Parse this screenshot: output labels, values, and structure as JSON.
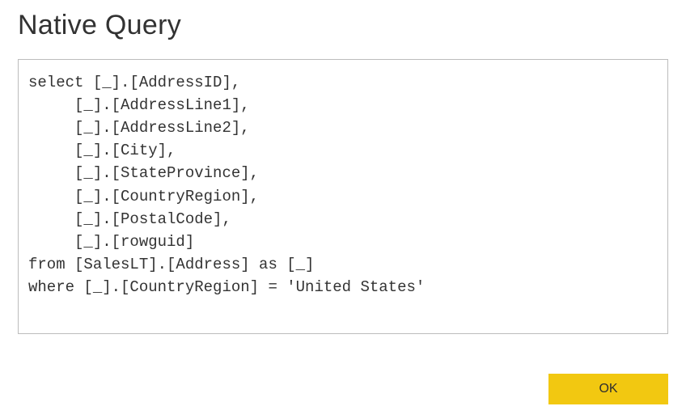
{
  "dialog": {
    "title": "Native Query"
  },
  "query": {
    "text": "select [_].[AddressID],\n     [_].[AddressLine1],\n     [_].[AddressLine2],\n     [_].[City],\n     [_].[StateProvince],\n     [_].[CountryRegion],\n     [_].[PostalCode],\n     [_].[rowguid]\nfrom [SalesLT].[Address] as [_]\nwhere [_].[CountryRegion] = 'United States'"
  },
  "buttons": {
    "ok_label": "OK"
  },
  "colors": {
    "accent": "#f2c811",
    "border": "#bcbcbc",
    "text_title": "#323232",
    "text_body": "#333333"
  }
}
